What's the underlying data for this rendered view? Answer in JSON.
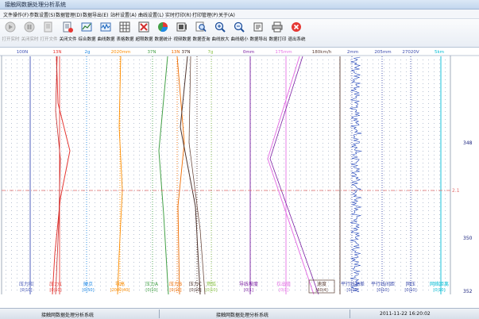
{
  "window": {
    "title": "接触网数据处理分析系统"
  },
  "menu": [
    {
      "label": "文件操作(F)"
    },
    {
      "label": "参数设置(S)"
    },
    {
      "label": "数据管理(D)"
    },
    {
      "label": "数据导出(E)"
    },
    {
      "label": "站杆设置(A)"
    },
    {
      "label": "曲线设置(L)"
    },
    {
      "label": "实时打印(R)"
    },
    {
      "label": "打印管理(P)"
    },
    {
      "label": "关于(A)"
    }
  ],
  "toolbar": [
    {
      "label": "打开实时",
      "icon": "play-icon",
      "enabled": false
    },
    {
      "label": "关闭实时",
      "icon": "pause-icon",
      "enabled": false
    },
    {
      "label": "打开文件",
      "icon": "open-file-icon",
      "enabled": false
    },
    {
      "label": "关闭文件",
      "icon": "close-file-icon",
      "enabled": true
    },
    {
      "label": "综合数据",
      "icon": "composite-data-icon",
      "enabled": true
    },
    {
      "label": "曲线数据",
      "icon": "curve-data-icon",
      "enabled": true
    },
    {
      "label": "表格数据",
      "icon": "table-data-icon",
      "enabled": true
    },
    {
      "label": "超限数据",
      "icon": "overlimit-data-icon",
      "enabled": true
    },
    {
      "label": "数据统计",
      "icon": "pie-chart-icon",
      "enabled": true
    },
    {
      "label": "视频数据",
      "icon": "video-data-icon",
      "enabled": true
    },
    {
      "label": "数据查询",
      "icon": "search-icon",
      "enabled": true
    },
    {
      "label": "曲线放大",
      "icon": "zoom-in-icon",
      "enabled": true
    },
    {
      "label": "曲线缩小",
      "icon": "zoom-out-icon",
      "enabled": true
    },
    {
      "label": "数据导出",
      "icon": "export-icon",
      "enabled": true
    },
    {
      "label": "数据打印",
      "icon": "printer-icon",
      "enabled": true
    },
    {
      "label": "退出系统",
      "icon": "exit-icon",
      "enabled": true
    }
  ],
  "scale_labels": [
    {
      "text": "100N",
      "color": "#3f51b5"
    },
    {
      "text": "13N",
      "color": "#e53935"
    },
    {
      "text": "2g",
      "color": "#1e88e5"
    },
    {
      "text": "2020mm",
      "color": "#fb8c00"
    },
    {
      "text": "37N",
      "color": "#43a047"
    },
    {
      "text": "13N",
      "color": "#ef6c00"
    },
    {
      "text": "37N",
      "color": "#3e2723"
    },
    {
      "text": "7g",
      "color": "#8bc34a"
    },
    {
      "text": "0mm",
      "color": "#7b1fa2"
    },
    {
      "text": "175mm",
      "color": "#e573e5"
    },
    {
      "text": "180km/h",
      "color": "#5d4037"
    },
    {
      "text": "2mm",
      "color": "#3949ab"
    },
    {
      "text": "205mm",
      "color": "#3949ab"
    },
    {
      "text": "27020V",
      "color": "#3949ab"
    },
    {
      "text": "5km",
      "color": "#00bcd4"
    }
  ],
  "channels": [
    {
      "name": "压力和",
      "range": "[0|10]",
      "color": "#3f51b5"
    },
    {
      "name": "压力1",
      "range": "[0|10]",
      "color": "#e53935"
    },
    {
      "name": "硬点",
      "range": "[0|50]",
      "color": "#1e88e5"
    },
    {
      "name": "导高",
      "range": "[2000|40]",
      "color": "#fb8c00"
    },
    {
      "name": "压力A",
      "range": "[0|10]",
      "color": "#43a047"
    },
    {
      "name": "压力B",
      "range": "[0|10]",
      "color": "#ef6c00"
    },
    {
      "name": "压力C",
      "range": "[0|10]",
      "color": "#4e342e"
    },
    {
      "name": "燃弧",
      "range": "[0|10]",
      "color": "#8bc34a"
    },
    {
      "name": "导线坡度",
      "range": "[0|1]",
      "color": "#7b1fa2"
    },
    {
      "name": "拉出值",
      "range": "[0|1]",
      "color": "#e573e5"
    },
    {
      "name": "速度",
      "range": "[60|4]",
      "color": "#5d4037"
    },
    {
      "name": "平行线高差",
      "range": "[0|10]",
      "color": "#3949ab"
    },
    {
      "name": "平行线间距",
      "range": "[0|10]",
      "color": "#3949ab"
    },
    {
      "name": "网压",
      "range": "[0|10]",
      "color": "#3949ab"
    },
    {
      "name": "网络距离",
      "range": "[0|10]",
      "color": "#00bcd4"
    }
  ],
  "mileage_ticks": [
    "348",
    "350",
    "352"
  ],
  "reference_level_label": "2.1",
  "status": {
    "left": "接触网数据处理分析系统",
    "middle": "接触网数据处理分析系统",
    "datetime": "2011-11-22 16:20:02"
  },
  "colors": {
    "grid_major": "#a7b4c8",
    "grid_dot": "#b8c2d3",
    "reference_line": "#e06a6a"
  }
}
